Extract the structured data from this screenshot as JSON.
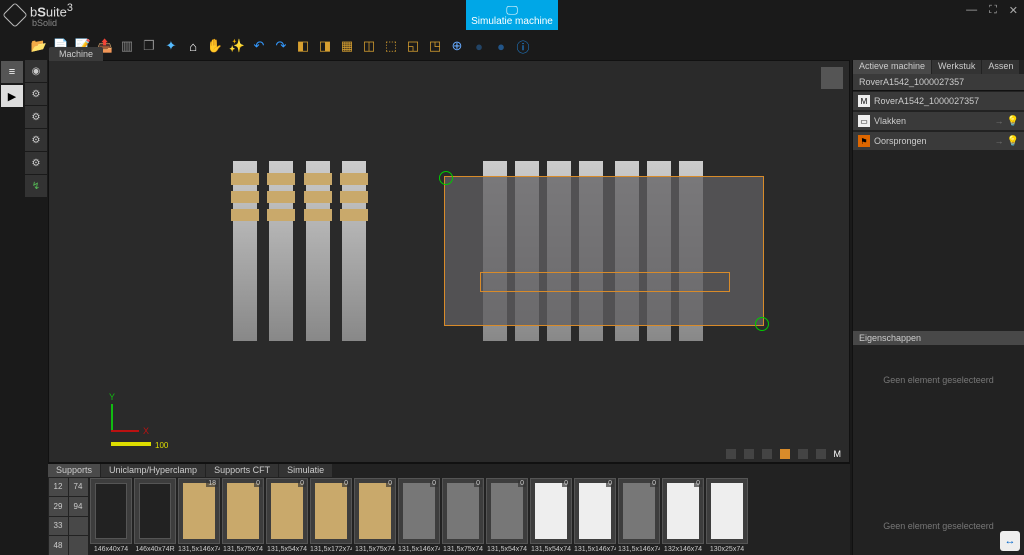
{
  "app": {
    "name_html": "bSuite³",
    "sub": "bSolid"
  },
  "sim_button": "Simulatie machine",
  "workspace_tab": "Machine",
  "axis": {
    "x": "X",
    "y": "Y",
    "scale": "100"
  },
  "right": {
    "tabs": [
      "Actieve machine",
      "Werkstuk",
      "Assen"
    ],
    "machine": "RoverA1542_1000027357",
    "tree": [
      {
        "label": "RoverA1542_1000027357",
        "arrow": false,
        "bulb": false,
        "icon": "pg"
      },
      {
        "label": "Vlakken",
        "arrow": true,
        "bulb": true,
        "icon": "pg"
      },
      {
        "label": "Oorsprongen",
        "arrow": true,
        "bulb": true,
        "icon": "fl"
      }
    ],
    "props_header": "Eigenschappen",
    "no_selection": "Geen element geselecteerd"
  },
  "bottom": {
    "tabs": [
      "Supports",
      "Uniclamp/Hyperclamp",
      "Supports CFT",
      "Simulatie"
    ],
    "sizes_col": [
      [
        "12",
        "74"
      ],
      [
        "29",
        "94"
      ],
      [
        "33",
        ""
      ],
      [
        "48",
        ""
      ]
    ],
    "supports": [
      {
        "label": "146x40x74",
        "kind": "dark",
        "badge": ""
      },
      {
        "label": "146x40x74R",
        "kind": "dark",
        "badge": ""
      },
      {
        "label": "131,5x146x74",
        "kind": "wood",
        "badge": "18"
      },
      {
        "label": "131,5x75x74",
        "kind": "wood",
        "badge": "0"
      },
      {
        "label": "131,5x54x74",
        "kind": "wood",
        "badge": "0"
      },
      {
        "label": "131,5x172x74",
        "kind": "wood",
        "badge": "0"
      },
      {
        "label": "131,5x75x74",
        "kind": "wood",
        "badge": "0"
      },
      {
        "label": "131,5x146x74",
        "kind": "grey",
        "badge": "0"
      },
      {
        "label": "131,5x75x74",
        "kind": "grey",
        "badge": "0"
      },
      {
        "label": "131,5x54x74",
        "kind": "grey",
        "badge": "0"
      },
      {
        "label": "131,5x54x74",
        "kind": "white",
        "badge": "0"
      },
      {
        "label": "131,5x146x74",
        "kind": "white",
        "badge": "0"
      },
      {
        "label": "131,5x146x74",
        "kind": "grey",
        "badge": "0"
      },
      {
        "label": "132x146x74",
        "kind": "white",
        "badge": "0"
      },
      {
        "label": "130x25x74",
        "kind": "white",
        "badge": ""
      }
    ],
    "no_selection": "Geen element geselecteerd"
  },
  "toolbar_icons": [
    "folder",
    "doc",
    "edit",
    "export",
    "layers",
    "copy",
    "target",
    "home",
    "hand",
    "wand",
    "undo",
    "redo",
    "box1",
    "box2",
    "box3",
    "box4",
    "box5",
    "box6",
    "grid",
    "globe1",
    "globe2",
    "globe3",
    "info"
  ],
  "left_tabs": [
    "≡",
    "▶"
  ],
  "left_tools": [
    "⬤",
    "⚙",
    "⚙",
    "⚙",
    "⚙",
    "↯"
  ]
}
